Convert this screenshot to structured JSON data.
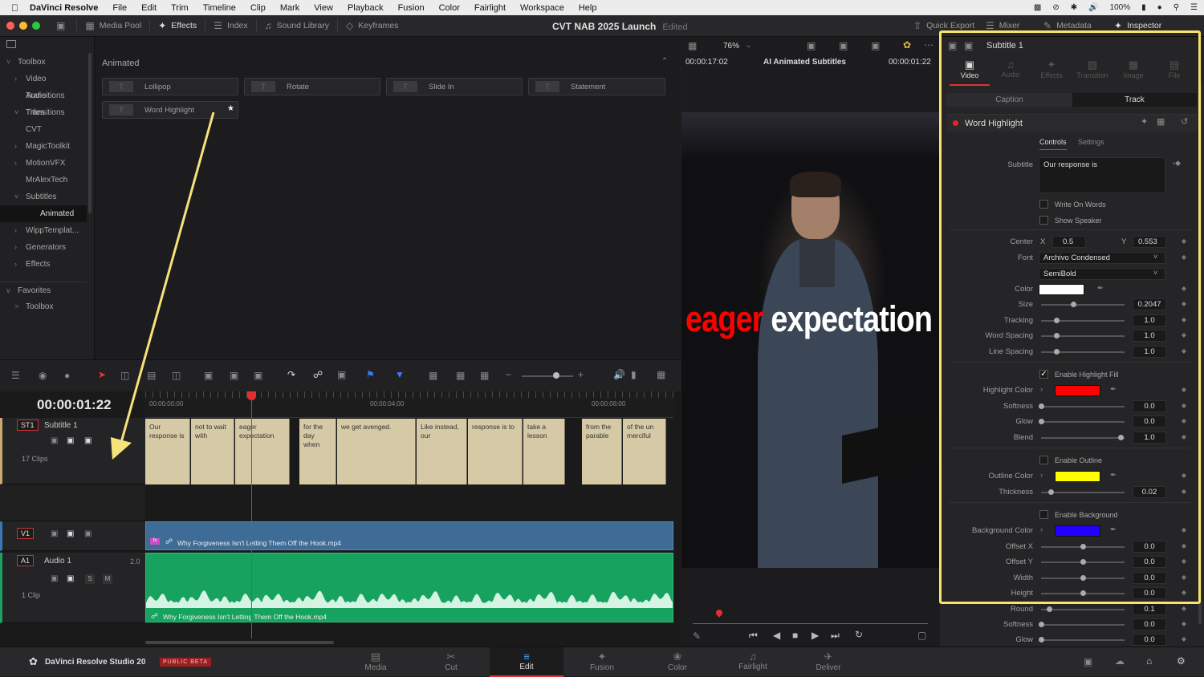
{
  "menubar": {
    "app": "DaVinci Resolve",
    "items": [
      "File",
      "Edit",
      "Trim",
      "Timeline",
      "Clip",
      "Mark",
      "View",
      "Playback",
      "Fusion",
      "Color",
      "Fairlight",
      "Workspace",
      "Help"
    ],
    "battery": "100%"
  },
  "toolbar": {
    "media_pool": "Media Pool",
    "effects": "Effects",
    "index": "Index",
    "sound_library": "Sound Library",
    "keyframes": "Keyframes",
    "quick_export": "Quick Export",
    "mixer": "Mixer",
    "metadata": "Metadata",
    "inspector": "Inspector"
  },
  "project": {
    "title": "CVT NAB 2025 Launch",
    "status": "Edited"
  },
  "toolbox": {
    "items": [
      {
        "label": "Toolbox",
        "indent": 0,
        "chev": "v"
      },
      {
        "label": "Video Transitions",
        "indent": 1,
        "chev": ">"
      },
      {
        "label": "Audio Transitions",
        "indent": 1,
        "chev": ""
      },
      {
        "label": "Titles",
        "indent": 1,
        "chev": "v"
      },
      {
        "label": "CVT",
        "indent": 2,
        "chev": ""
      },
      {
        "label": "MagicToolkit",
        "indent": 2,
        "chev": ">"
      },
      {
        "label": "MotionVFX",
        "indent": 2,
        "chev": ">"
      },
      {
        "label": "MrAlexTech",
        "indent": 2,
        "chev": ""
      },
      {
        "label": "Subtitles",
        "indent": 2,
        "chev": "v"
      },
      {
        "label": "Animated",
        "indent": 3,
        "chev": "",
        "selected": true
      },
      {
        "label": "WippTemplat...",
        "indent": 2,
        "chev": ">"
      },
      {
        "label": "Generators",
        "indent": 1,
        "chev": ">"
      },
      {
        "label": "Effects",
        "indent": 1,
        "chev": ">"
      }
    ],
    "favorites": "Favorites",
    "fav_toolbox": "Toolbox"
  },
  "effects_panel": {
    "header": "Animated",
    "cards": [
      "Lollipop",
      "Rotate",
      "Slide In",
      "Statement",
      "Word Highlight"
    ]
  },
  "timeline": {
    "timecode": "00:00:01:22",
    "ruler": [
      "00:00:00:00",
      "00:00:04:00",
      "00:00:08:00"
    ],
    "st1": {
      "tag": "ST1",
      "name": "Subtitle 1",
      "clips": "17 Clips"
    },
    "subtitles": [
      "Our response is",
      "not to wait with",
      "eager expectation",
      "for the day when",
      "we get avenged.",
      "Like instead, our",
      "response is to",
      "take a lesson",
      "from the parable",
      "of the un merciful"
    ],
    "v1": {
      "tag": "V1",
      "clip": "Why Forgiveness Isn't Letting Them Off the Hook.mp4"
    },
    "a1": {
      "tag": "A1",
      "name": "Audio 1",
      "level": "2.0",
      "clips": "1 Clip",
      "clip": "Why Forgiveness Isn't Letting Them Off the Hook.mp4",
      "solo": "S",
      "mute": "M"
    }
  },
  "viewer": {
    "zoom": "76%",
    "timecode_left": "00:00:17:02",
    "name": "AI Animated Subtitles",
    "timecode_right": "00:00:01:22",
    "caption_red": "eager",
    "caption_white": "expectation"
  },
  "inspector": {
    "title": "Subtitle 1",
    "tabs": [
      "Video",
      "Audio",
      "Effects",
      "Transition",
      "Image",
      "File"
    ],
    "subtabs": [
      "Caption",
      "Track"
    ],
    "effect_name": "Word Highlight",
    "ctrl_tabs": [
      "Controls",
      "Settings"
    ],
    "subtitle_label": "Subtitle",
    "subtitle_value": "Our response is",
    "write_on": "Write On Words",
    "show_speaker": "Show Speaker",
    "center_label": "Center",
    "x_label": "X",
    "x_value": "0.5",
    "y_label": "Y",
    "y_value": "0.553",
    "font_label": "Font",
    "font_value": "Archivo Condensed",
    "font_style": "SemiBold",
    "color_label": "Color",
    "size_label": "Size",
    "size_value": "0.2047",
    "tracking_label": "Tracking",
    "tracking_value": "1.0",
    "word_spacing_label": "Word Spacing",
    "word_spacing_value": "1.0",
    "line_spacing_label": "Line Spacing",
    "line_spacing_value": "1.0",
    "enable_highlight": "Enable Highlight Fill",
    "highlight_color_label": "Highlight Color",
    "softness_label": "Softness",
    "softness_value": "0.0",
    "glow_label": "Glow",
    "glow_value": "0.0",
    "blend_label": "Blend",
    "blend_value": "1.0",
    "enable_outline": "Enable Outline",
    "outline_color_label": "Outline Color",
    "thickness_label": "Thickness",
    "thickness_value": "0.02",
    "enable_background": "Enable Background",
    "background_color_label": "Background Color",
    "offset_x_label": "Offset X",
    "offset_x_value": "0.0",
    "offset_y_label": "Offset Y",
    "offset_y_value": "0.0",
    "width_label": "Width",
    "width_value": "0.0",
    "height_label": "Height",
    "height_value": "0.0",
    "round_label": "Round",
    "round_value": "0.1",
    "softness2_label": "Softness",
    "softness2_value": "0.0",
    "glow2_label": "Glow",
    "glow2_value": "0.0",
    "colors": {
      "text": "#ffffff",
      "highlight": "#ff0000",
      "outline": "#ffff00",
      "background": "#2200ff"
    }
  },
  "pages": [
    "Media",
    "Cut",
    "Edit",
    "Fusion",
    "Color",
    "Fairlight",
    "Deliver"
  ],
  "brand": {
    "name": "DaVinci Resolve Studio 20",
    "badge": "PUBLIC BETA"
  }
}
